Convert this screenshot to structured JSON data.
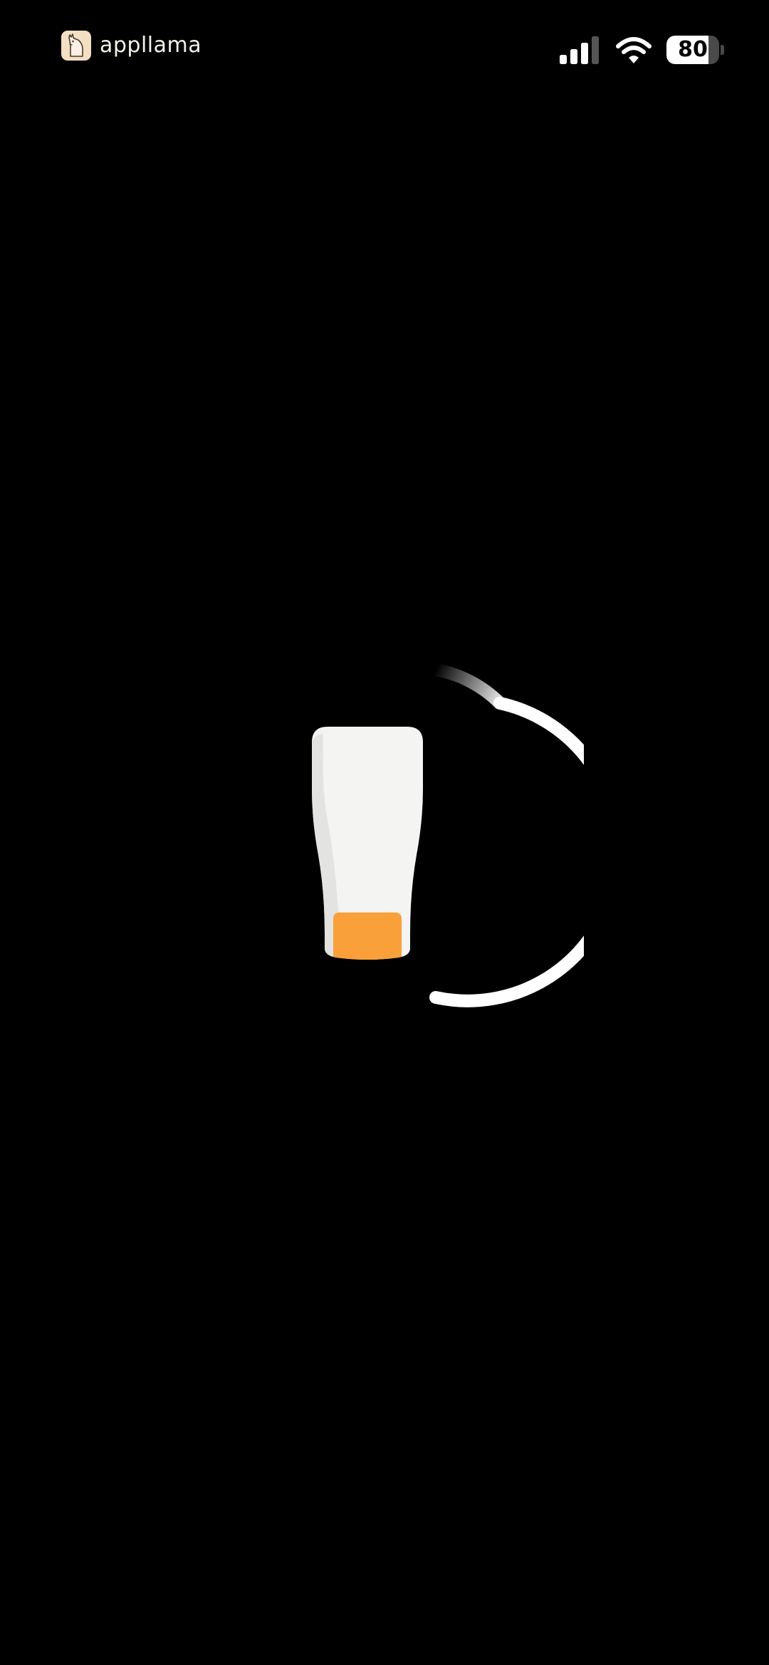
{
  "watermark": {
    "brand_text": "appllama",
    "logo_icon": "llama-logo-icon"
  },
  "status_bar": {
    "signal_icon": "cellular-signal-icon",
    "wifi_icon": "wifi-icon",
    "battery_level": 80,
    "battery_label": "80"
  },
  "loader": {
    "icon": "beer-glass-icon",
    "spinner": "loading-spinner-arc",
    "fill_level": 0.2,
    "colors": {
      "background": "#000000",
      "glass": "#f4f4f3",
      "liquid": "#f9a03a",
      "spinner": "#ffffff"
    }
  }
}
